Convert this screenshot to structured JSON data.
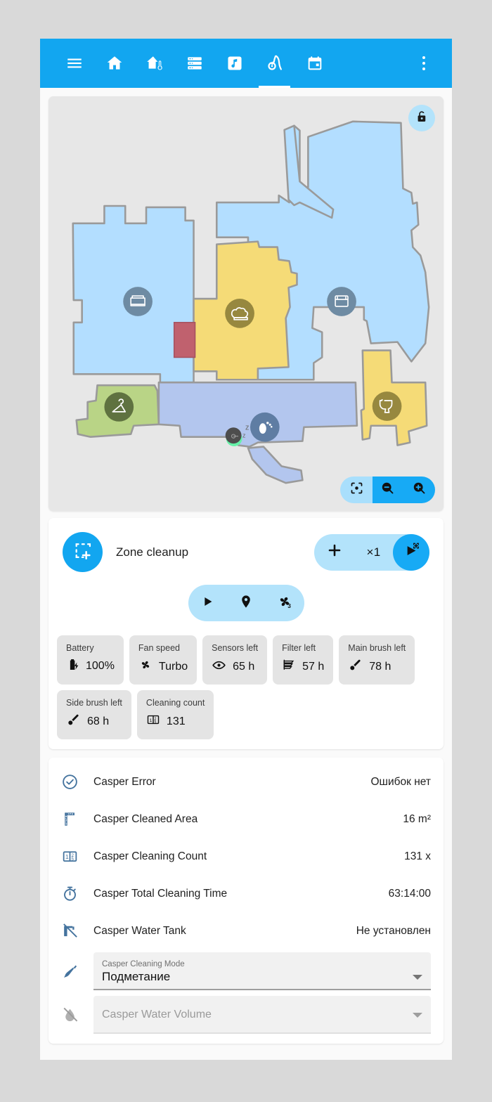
{
  "theme": {
    "primary": "#12a6f0",
    "primary_light": "#b3e3fb",
    "page_bg": "#d9d9d9",
    "surface": "#ffffff",
    "map_bg": "#e7e7e7",
    "chip_bg": "#e4e4e4",
    "entity_icon": "#44739e"
  },
  "appbar": {
    "tabs": [
      {
        "icon": "hamburger-menu-icon",
        "name": "menu",
        "active": false
      },
      {
        "icon": "home-icon",
        "name": "home",
        "active": false
      },
      {
        "icon": "house-thermometer-icon",
        "name": "climate",
        "active": false
      },
      {
        "icon": "server-list-icon",
        "name": "devices",
        "active": false
      },
      {
        "icon": "music-note-icon",
        "name": "media",
        "active": false
      },
      {
        "icon": "vacuum-icon",
        "name": "vacuum",
        "active": true
      },
      {
        "icon": "calendar-icon",
        "name": "calendar",
        "active": false
      }
    ],
    "overflow_icon": "three-dot-menu-icon"
  },
  "map": {
    "lock_icon": "unlocked-padlock-icon",
    "controls": [
      {
        "icon": "center-focus-icon",
        "name": "recenter"
      },
      {
        "icon": "zoom-out-icon",
        "name": "zoom-out"
      },
      {
        "icon": "zoom-in-icon",
        "name": "zoom-in"
      }
    ],
    "rooms": [
      {
        "name": "living-room",
        "icon": "sofa-icon",
        "color": "#b3deff",
        "badge_color": "#6e8ba3"
      },
      {
        "name": "kitchen",
        "icon": "chef-hat-icon",
        "color": "#f5db77",
        "badge_color": "#97883f"
      },
      {
        "name": "bedroom",
        "icon": "bed-icon",
        "color": "#b3deff",
        "badge_color": "#6e8ba3"
      },
      {
        "name": "bathroom-toilet",
        "icon": "toilet-icon",
        "color": "#f5db77",
        "badge_color": "#97883f"
      },
      {
        "name": "closet",
        "icon": "hanger-icon",
        "color": "#b9d486",
        "badge_color": "#5f7240"
      },
      {
        "name": "hallway-bathroom",
        "icon": "footprint-icon",
        "color": "#b3c6ee",
        "badge_color": "#5f7da3"
      }
    ],
    "no_go_zone_color": "#c0616e",
    "robot": {
      "name": "robot-marker",
      "status_icon": "sleep-zz-icon",
      "zz_text": "z"
    }
  },
  "controls": {
    "zone_icon": "zone-cleanup-icon",
    "zone_label": "Zone cleanup",
    "plus_label": "+",
    "repeat_count": "×1",
    "play_icon": "play-zone-icon",
    "mode_buttons": [
      {
        "icon": "play-icon",
        "name": "start"
      },
      {
        "icon": "map-pin-icon",
        "name": "goto"
      },
      {
        "icon": "fan-speed-3-icon",
        "name": "fan-speed",
        "badge": "3"
      }
    ]
  },
  "chips": [
    {
      "key": "Battery",
      "value": "100%",
      "icon": "battery-charging-icon"
    },
    {
      "key": "Fan speed",
      "value": "Turbo",
      "icon": "fan-icon"
    },
    {
      "key": "Sensors left",
      "value": "65 h",
      "icon": "eye-icon"
    },
    {
      "key": "Filter left",
      "value": "57 h",
      "icon": "air-filter-icon"
    },
    {
      "key": "Main brush left",
      "value": "78 h",
      "icon": "brush-icon"
    },
    {
      "key": "Side brush left",
      "value": "68 h",
      "icon": "brush-icon"
    },
    {
      "key": "Cleaning count",
      "value": "131",
      "icon": "counter-icon"
    }
  ],
  "entities": [
    {
      "icon": "check-circle-icon",
      "name": "Casper Error",
      "value": "Ошибок нет"
    },
    {
      "icon": "ruler-icon",
      "name": "Casper Cleaned Area",
      "value": "16 m²"
    },
    {
      "icon": "counter-icon",
      "name": "Casper Cleaning Count",
      "value": "131 x"
    },
    {
      "icon": "timer-icon",
      "name": "Casper Total Cleaning Time",
      "value": "63:14:00"
    },
    {
      "icon": "water-pump-off-icon",
      "name": "Casper Water Tank",
      "value": "Не установлен"
    }
  ],
  "selects": [
    {
      "icon": "broom-icon",
      "label": "Casper Cleaning Mode",
      "value": "Подметание",
      "placeholder": "",
      "disabled": false,
      "caret_icon": "chevron-down-icon"
    },
    {
      "icon": "water-off-icon",
      "label": "",
      "value": "",
      "placeholder": "Casper Water Volume",
      "disabled": true,
      "caret_icon": "chevron-down-icon"
    }
  ]
}
